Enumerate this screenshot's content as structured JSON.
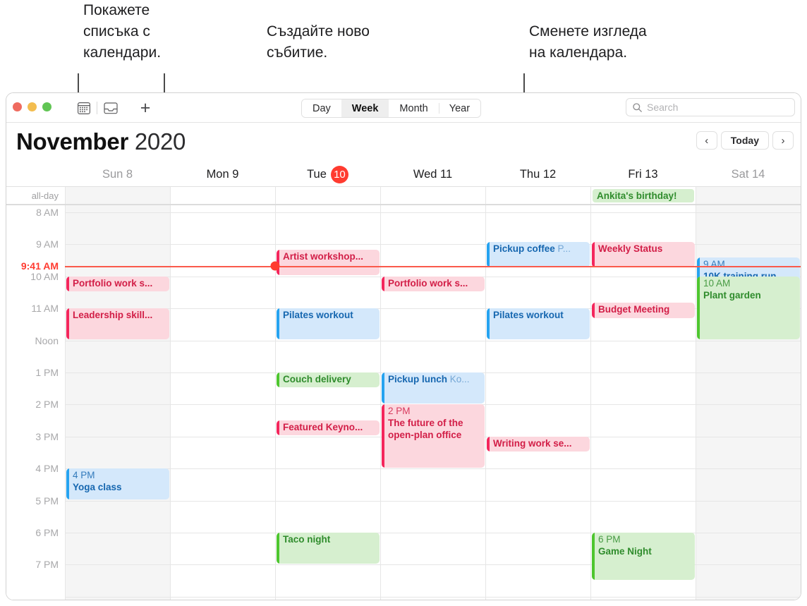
{
  "callouts": [
    {
      "id": "show-calendar-list",
      "text": "Покажете\nсписъка с\nкалендари."
    },
    {
      "id": "create-new-event",
      "text": "Създайте ново\nсъбитие."
    },
    {
      "id": "change-calendar-view",
      "text": "Сменете изгледа\nна календара."
    }
  ],
  "toolbar": {
    "calendar_list_icon": "calendar-icon",
    "inbox_icon": "inbox-icon",
    "add_label": "+",
    "views": [
      {
        "label": "Day",
        "selected": false
      },
      {
        "label": "Week",
        "selected": true
      },
      {
        "label": "Month",
        "selected": false
      },
      {
        "label": "Year",
        "selected": false
      }
    ],
    "search": {
      "placeholder": "Search",
      "value": "",
      "icon": "search-icon"
    }
  },
  "header": {
    "month": "November",
    "year": "2020",
    "prev_label": "‹",
    "today_label": "Today",
    "next_label": "›"
  },
  "days": [
    {
      "label": "Sun 8",
      "weekend": true,
      "badge": null
    },
    {
      "label": "Mon 9",
      "weekend": false,
      "badge": null
    },
    {
      "label": "Tue",
      "weekend": false,
      "badge": "10"
    },
    {
      "label": "Wed 11",
      "weekend": false,
      "badge": null
    },
    {
      "label": "Thu 12",
      "weekend": false,
      "badge": null
    },
    {
      "label": "Fri 13",
      "weekend": false,
      "badge": null
    },
    {
      "label": "Sat 14",
      "weekend": true,
      "badge": null
    }
  ],
  "allday": {
    "label": "all-day",
    "events": [
      {
        "day": 5,
        "title": "Ankita's birthday!",
        "color": "green"
      }
    ]
  },
  "time_labels": [
    "8 AM",
    "9 AM",
    "10 AM",
    "11 AM",
    "Noon",
    "1 PM",
    "2 PM",
    "3 PM",
    "4 PM",
    "5 PM",
    "6 PM",
    "7 PM"
  ],
  "now": {
    "label": "9:41 AM",
    "hour": 9.68,
    "day": 2
  },
  "events": [
    {
      "day": 2,
      "start": 9.17,
      "end": 10.0,
      "title": "Artist workshop...",
      "time": null,
      "loc": null,
      "color": "red"
    },
    {
      "day": 0,
      "start": 10.0,
      "end": 10.5,
      "title": "Portfolio work s...",
      "time": null,
      "loc": null,
      "color": "red"
    },
    {
      "day": 3,
      "start": 10.0,
      "end": 10.5,
      "title": "Portfolio work s...",
      "time": null,
      "loc": null,
      "color": "red"
    },
    {
      "day": 0,
      "start": 11.0,
      "end": 12.0,
      "title": "Leadership skill...",
      "time": null,
      "loc": null,
      "color": "red"
    },
    {
      "day": 2,
      "start": 11.0,
      "end": 12.0,
      "title": "Pilates workout",
      "time": null,
      "loc": null,
      "color": "blue"
    },
    {
      "day": 4,
      "start": 11.0,
      "end": 12.0,
      "title": "Pilates workout",
      "time": null,
      "loc": null,
      "color": "blue"
    },
    {
      "day": 4,
      "start": 8.92,
      "end": 9.75,
      "title": "Pickup coffee",
      "time": null,
      "loc": "P...",
      "color": "blue"
    },
    {
      "day": 5,
      "start": 8.92,
      "end": 9.75,
      "title": "Weekly Status",
      "time": null,
      "loc": null,
      "color": "red"
    },
    {
      "day": 5,
      "start": 10.83,
      "end": 11.33,
      "title": "Budget Meeting",
      "time": null,
      "loc": null,
      "color": "red"
    },
    {
      "day": 6,
      "start": 9.42,
      "end": 11.0,
      "title": "10K training run",
      "time": "9 AM",
      "loc": null,
      "color": "blue"
    },
    {
      "day": 6,
      "start": 10.0,
      "end": 12.0,
      "title": "Plant garden",
      "time": "10 AM",
      "loc": null,
      "color": "green"
    },
    {
      "day": 2,
      "start": 13.0,
      "end": 13.5,
      "title": "Couch delivery",
      "time": null,
      "loc": null,
      "color": "green"
    },
    {
      "day": 3,
      "start": 13.0,
      "end": 14.0,
      "title": "Pickup lunch",
      "time": null,
      "loc": "Ko...",
      "color": "blue"
    },
    {
      "day": 2,
      "start": 14.5,
      "end": 15.0,
      "title": "Featured Keyno...",
      "time": null,
      "loc": null,
      "color": "red"
    },
    {
      "day": 3,
      "start": 14.0,
      "end": 16.0,
      "title": "The future of the open-plan office",
      "time": "2 PM",
      "loc": null,
      "color": "red",
      "wrap": true
    },
    {
      "day": 4,
      "start": 15.0,
      "end": 15.5,
      "title": "Writing work se...",
      "time": null,
      "loc": null,
      "color": "red"
    },
    {
      "day": 0,
      "start": 16.0,
      "end": 17.0,
      "title": "Yoga class",
      "time": "4 PM",
      "loc": null,
      "color": "blue"
    },
    {
      "day": 2,
      "start": 18.0,
      "end": 19.0,
      "title": "Taco night",
      "time": null,
      "loc": null,
      "color": "green"
    },
    {
      "day": 5,
      "start": 18.0,
      "end": 19.5,
      "title": "Game Night",
      "time": "6 PM",
      "loc": null,
      "color": "green"
    }
  ]
}
